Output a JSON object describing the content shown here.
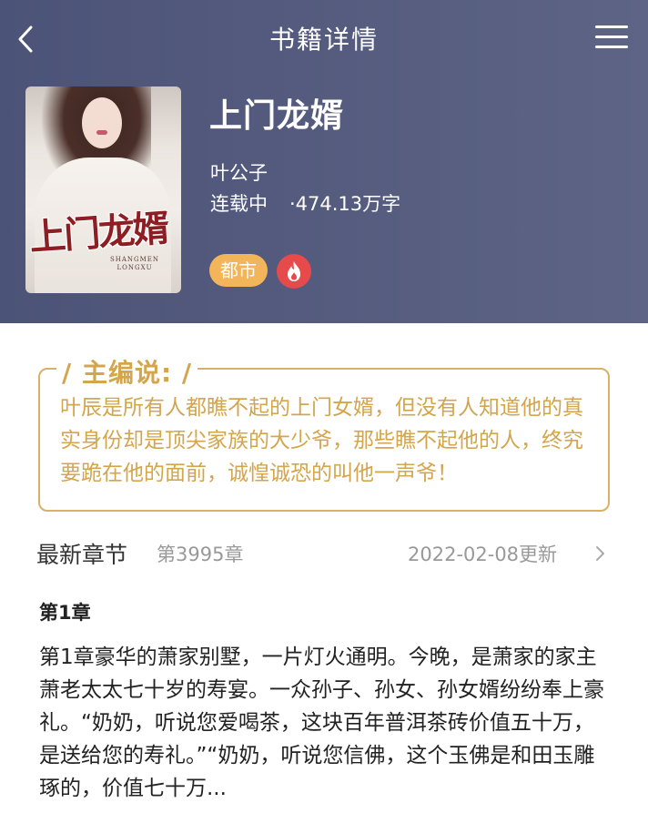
{
  "header": {
    "title": "书籍详情",
    "back_icon": "back-arrow-icon",
    "menu_icon": "menu-icon",
    "background": "#535a7d"
  },
  "book": {
    "cover_title": "上门龙婿",
    "cover_subtitle": "SHANGMEN LONGXU",
    "title": "上门龙婿",
    "author": "叶公子",
    "status": "连载中",
    "word_count": "·474.13万字",
    "genre_tag": "都市",
    "hot_icon": "flame-icon",
    "genre_color": "#f3b55a",
    "hot_color": "#e74a4b"
  },
  "editor": {
    "label": "/ 主编说: /",
    "text": "叶辰是所有人都瞧不起的上门女婿，但没有人知道他的真实身份却是顶尖家族的大少爷，那些瞧不起他的人，终究要跪在他的面前，诚惶诚恐的叫他一声爷！",
    "accent": "#d3a54c"
  },
  "latest": {
    "label": "最新章节",
    "chapter": "第3995章",
    "updated": "2022-02-08更新"
  },
  "first_chapter": {
    "title": "第1章",
    "excerpt": "第1章豪华的萧家别墅，一片灯火通明。今晚，是萧家的家主萧老太太七十岁的寿宴。一众孙子、孙女、孙女婿纷纷奉上豪礼。“奶奶，听说您爱喝茶，这块百年普洱茶砖价值五十万，是送给您的寿礼。”“奶奶，听说您信佛，这个玉佛是和田玉雕琢的，价值七十万..."
  }
}
